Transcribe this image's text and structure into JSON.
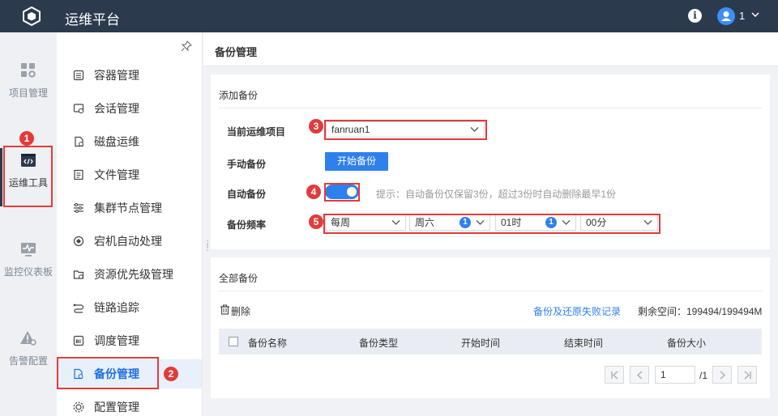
{
  "app": {
    "title": "运维平台"
  },
  "header": {
    "user_name": "1"
  },
  "rail": {
    "items": [
      {
        "label": "项目管理",
        "icon": "grid-settings-icon"
      },
      {
        "label": "运维工具",
        "icon": "code-window-icon"
      },
      {
        "label": "监控仪表板",
        "icon": "monitor-pulse-icon"
      },
      {
        "label": "告警配置",
        "icon": "alert-gear-icon"
      }
    ]
  },
  "menu": {
    "items": [
      {
        "label": "容器管理",
        "icon": "container-icon"
      },
      {
        "label": "会话管理",
        "icon": "session-icon"
      },
      {
        "label": "磁盘运维",
        "icon": "disk-icon"
      },
      {
        "label": "文件管理",
        "icon": "file-icon"
      },
      {
        "label": "集群节点管理",
        "icon": "cluster-icon"
      },
      {
        "label": "宕机自动处理",
        "icon": "auto-recover-icon"
      },
      {
        "label": "资源优先级管理",
        "icon": "priority-icon"
      },
      {
        "label": "链路追踪",
        "icon": "trace-icon"
      },
      {
        "label": "调度管理",
        "icon": "schedule-icon"
      },
      {
        "label": "备份管理",
        "icon": "backup-icon"
      },
      {
        "label": "配置管理",
        "icon": "config-icon"
      }
    ]
  },
  "page": {
    "title": "备份管理"
  },
  "add_backup": {
    "title": "添加备份",
    "project_label": "当前运维项目",
    "project_value": "fanruan1",
    "manual_label": "手动备份",
    "manual_button": "开始备份",
    "auto_label": "自动备份",
    "auto_enabled": true,
    "auto_hint": "提示：自动备份仅保留3份，超过3份时自动删除最早1份",
    "freq_label": "备份频率",
    "freq_period": "每周",
    "freq_day": "周六",
    "freq_hour": "01时",
    "freq_minute": "00分",
    "freq_day_dot": "1",
    "freq_hour_dot": "1"
  },
  "all_backups": {
    "title": "全部备份",
    "delete_label": "删除",
    "failure_log_link": "备份及还原失败记录",
    "space_label": "剩余空间：199494/199494M",
    "columns": [
      "备份名称",
      "备份类型",
      "开始时间",
      "结束时间",
      "备份大小"
    ],
    "page_input": "1",
    "page_total": "/1"
  },
  "callouts": [
    "1",
    "2",
    "3",
    "4",
    "5"
  ],
  "colors": {
    "topbar": "#2b3a4d",
    "accent": "#2f80ed",
    "callout": "#e23b3b",
    "active_menu_bg": "#e8f0fb"
  }
}
